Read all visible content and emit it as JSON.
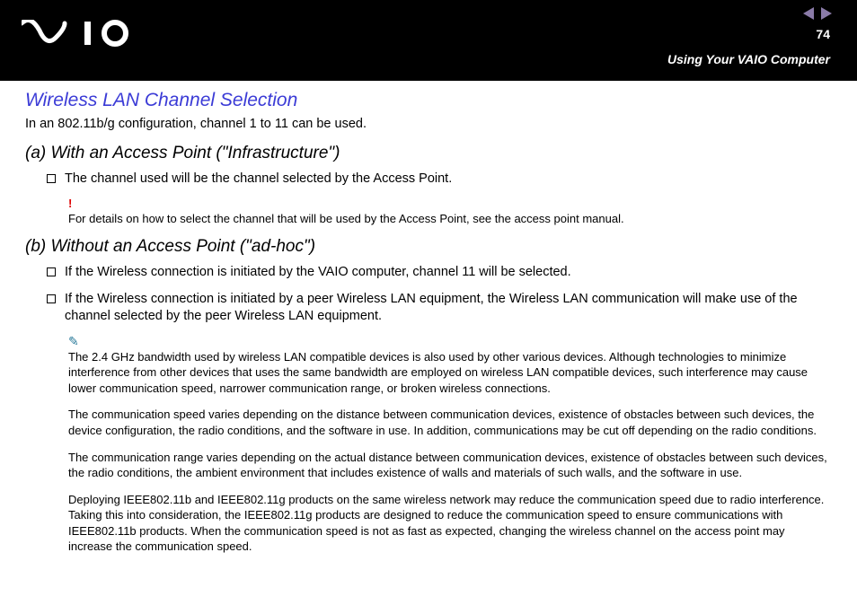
{
  "header": {
    "page_number": "74",
    "breadcrumb": "Using Your VAIO Computer"
  },
  "title": "Wireless LAN Channel Selection",
  "intro": "In an 802.11b/g configuration, channel 1 to 11 can be used.",
  "section_a": {
    "heading": "(a) With an Access Point (\"Infrastructure\")",
    "bullet1": "The channel used will be the channel selected by the Access Point.",
    "bang_note": "For details on how to select the channel that will be used by the Access Point, see the access point manual."
  },
  "section_b": {
    "heading": "(b) Without an Access Point (\"ad-hoc\")",
    "bullet1": "If the Wireless connection is initiated by the VAIO computer, channel 11 will be selected.",
    "bullet2": "If the Wireless connection is initiated by a peer Wireless LAN equipment, the Wireless LAN communication will make use of the channel selected by the peer Wireless LAN equipment.",
    "note1": "The 2.4 GHz bandwidth used by wireless LAN compatible devices is also used by other various devices. Although technologies to minimize interference from other devices that uses the same bandwidth are employed on wireless LAN compatible devices, such interference may cause lower communication speed, narrower communication range, or broken wireless connections.",
    "note2": "The communication speed varies depending on the distance between communication devices, existence of obstacles between such devices, the device configuration, the radio conditions, and the software in use. In addition, communications may be cut off depending on the radio conditions.",
    "note3": "The communication range varies depending on the actual distance between communication devices, existence of obstacles between such devices, the radio conditions, the ambient environment that includes existence of walls and materials of such walls, and the software in use.",
    "note4": "Deploying IEEE802.11b and IEEE802.11g products on the same wireless network may reduce the communication speed due to radio interference. Taking this into consideration, the IEEE802.11g products are designed to reduce the communication speed to ensure communications with IEEE802.11b products. When the communication speed is not as fast as expected, changing the wireless channel on the access point may increase the communication speed."
  },
  "icons": {
    "bang": "!",
    "pen": "✎"
  }
}
